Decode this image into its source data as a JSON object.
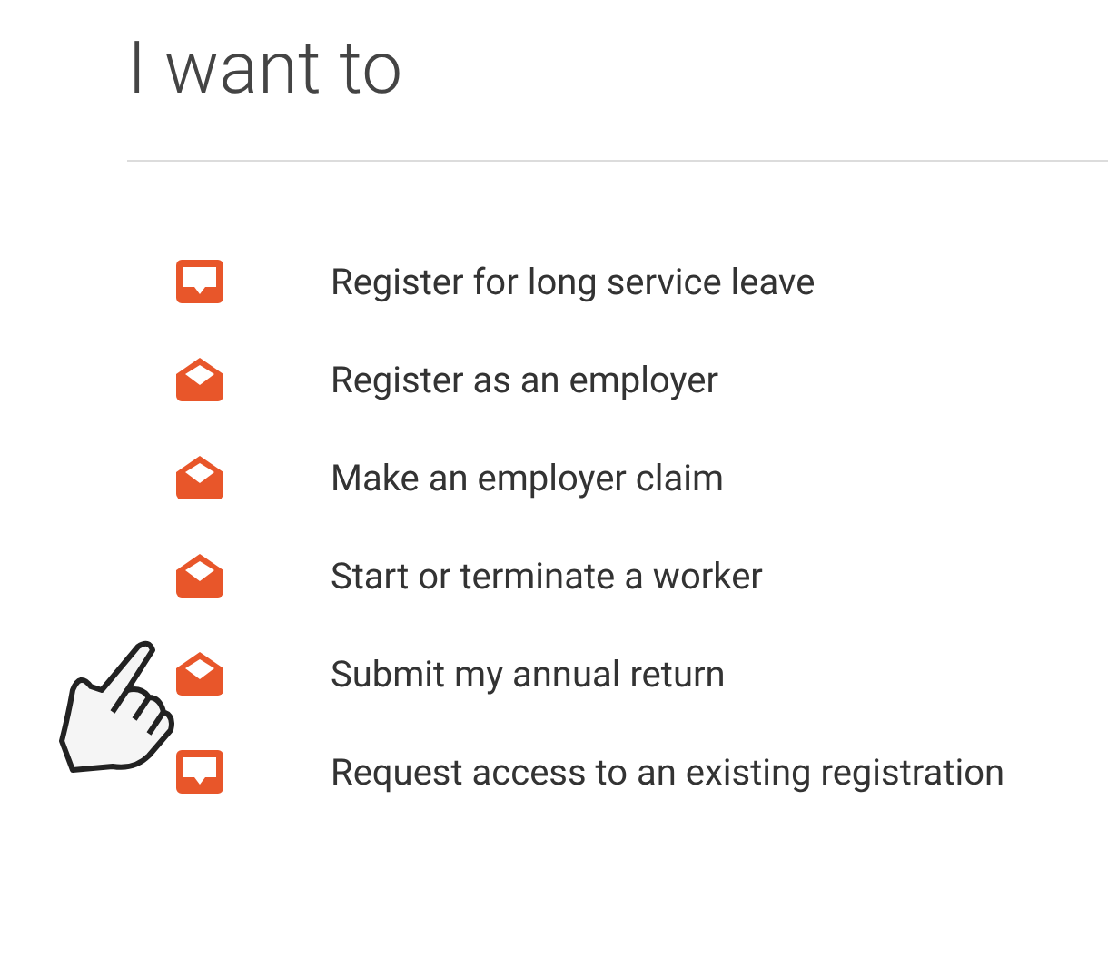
{
  "title": "I want to",
  "items": [
    {
      "kind": "inbox",
      "label": "Register for long service leave"
    },
    {
      "kind": "envelope",
      "label": "Register as an employer"
    },
    {
      "kind": "envelope",
      "label": "Make an employer claim"
    },
    {
      "kind": "envelope",
      "label": "Start or terminate a worker"
    },
    {
      "kind": "envelope",
      "label": "Submit my annual return"
    },
    {
      "kind": "inbox",
      "label": "Request access to an existing registration"
    }
  ]
}
